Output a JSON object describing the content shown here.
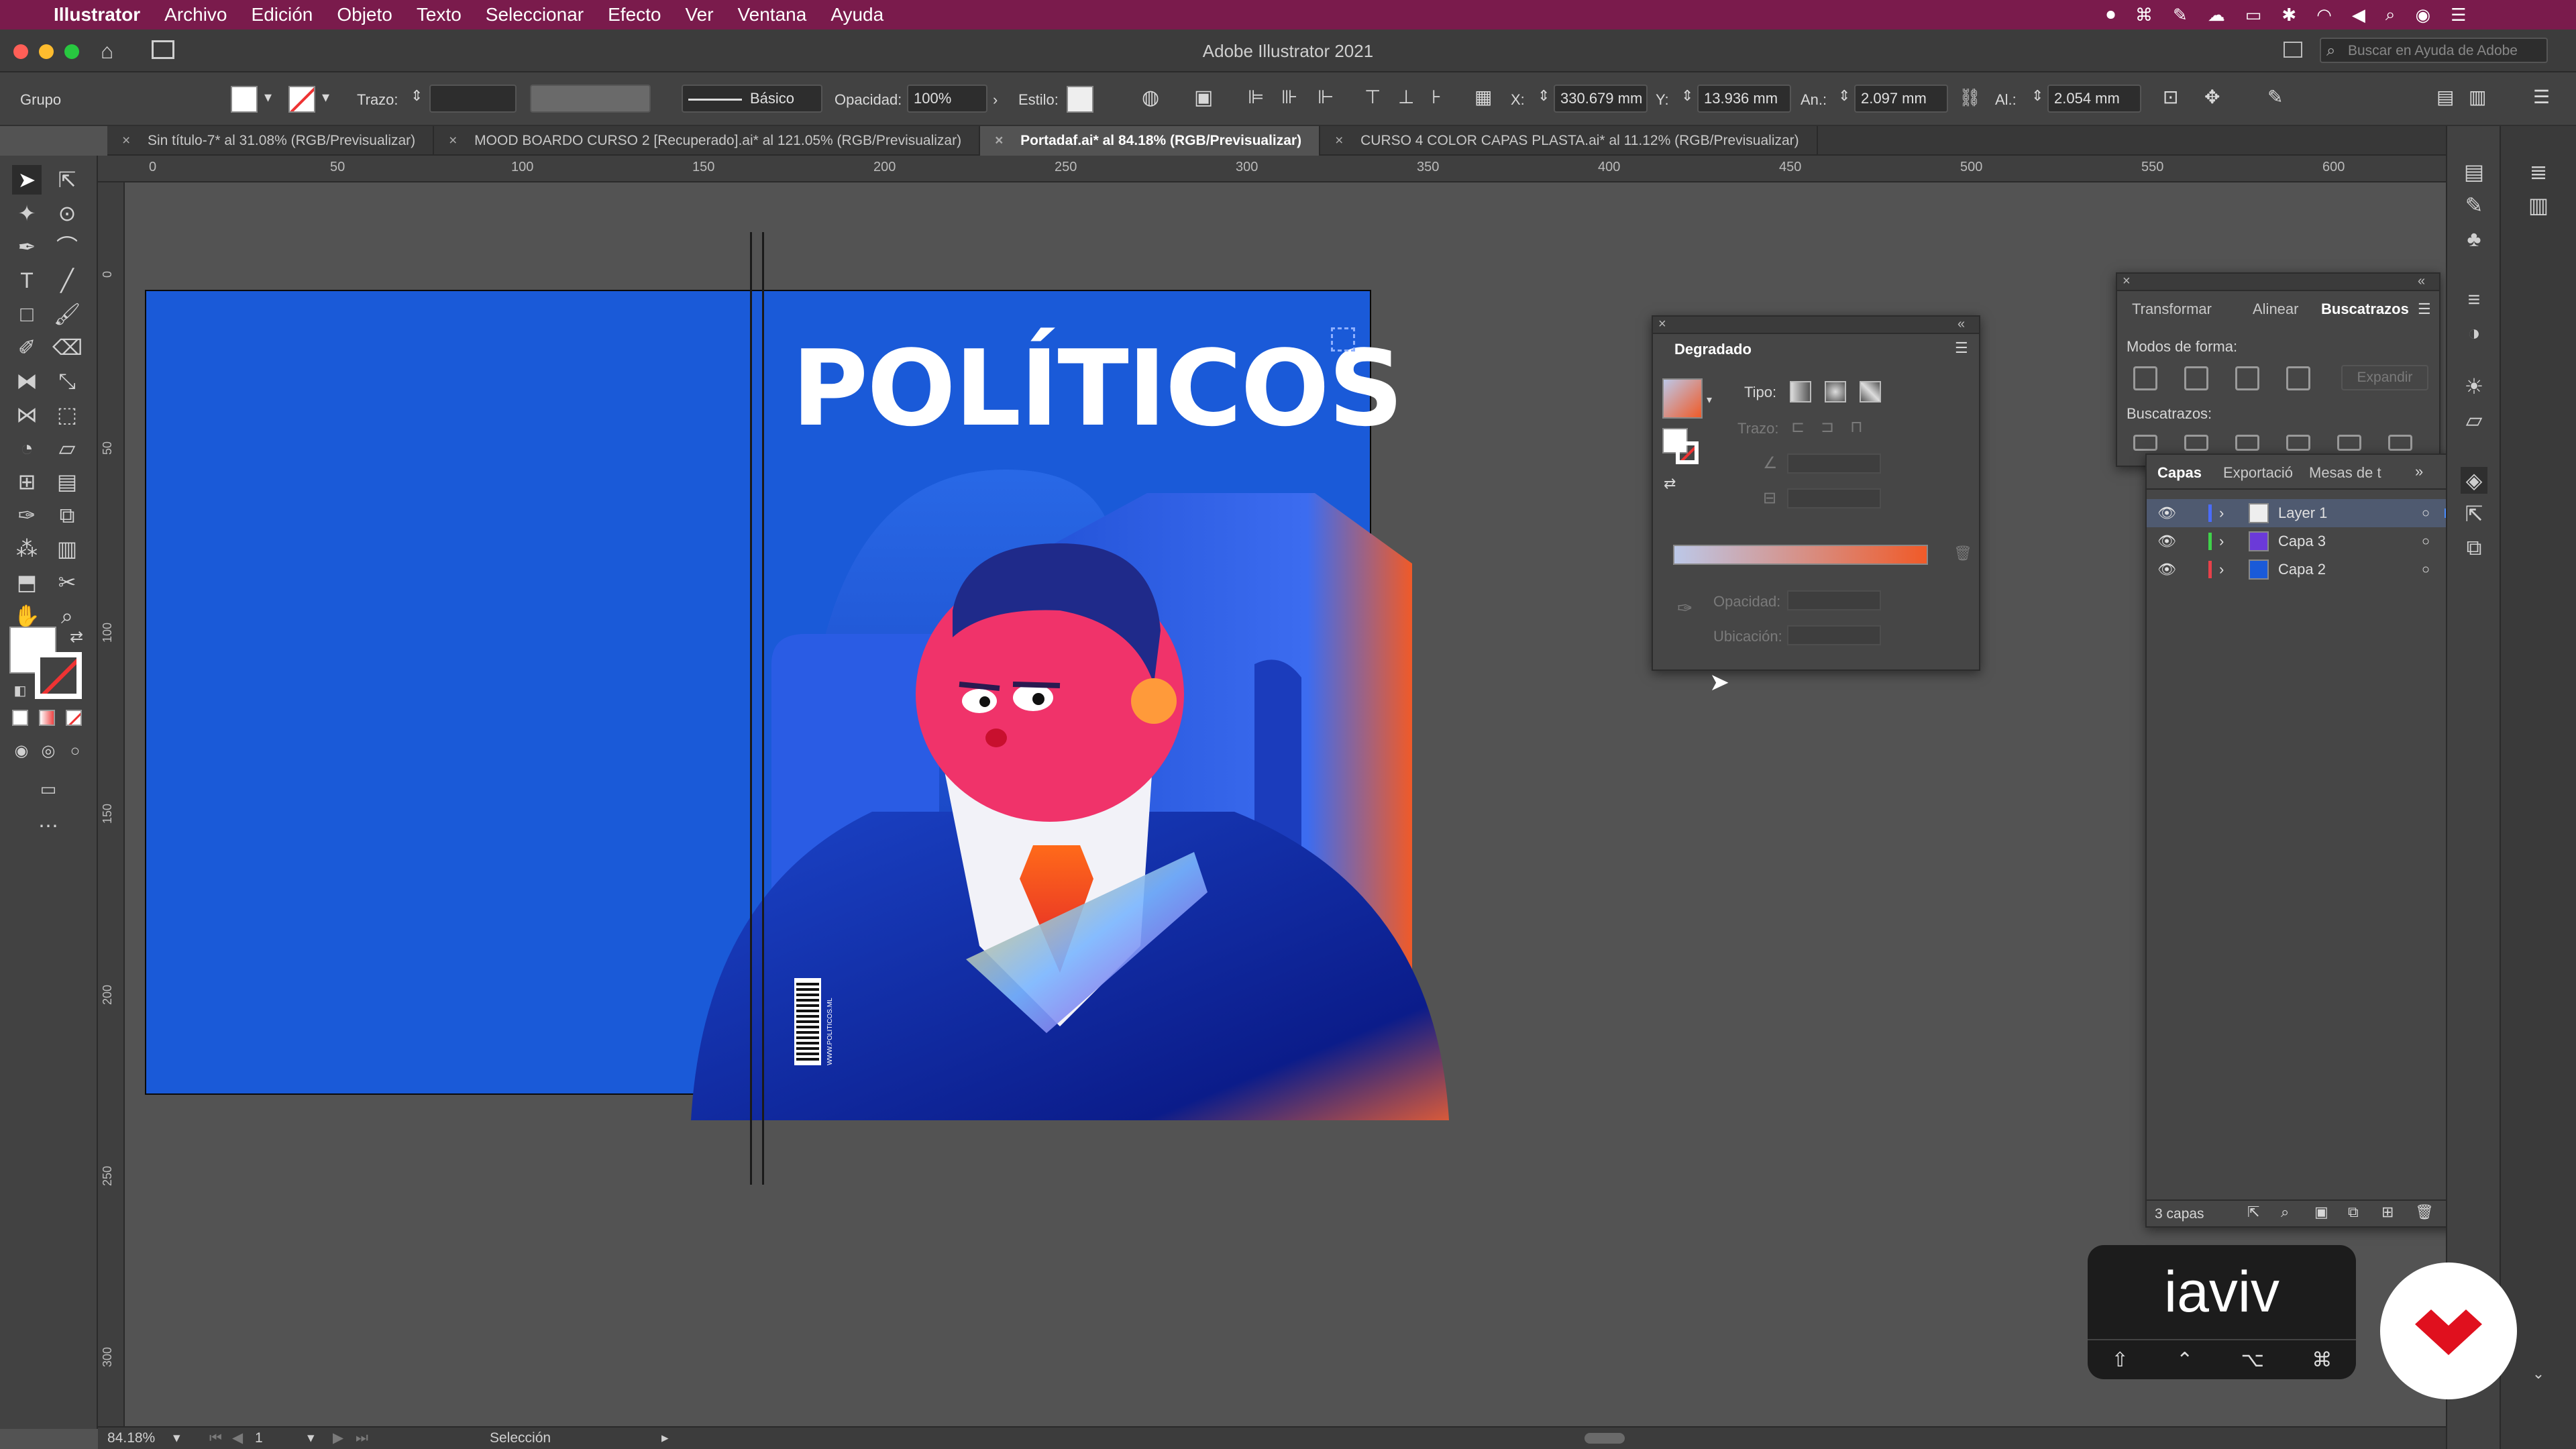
{
  "menubar": {
    "apple": "",
    "app": "Illustrator",
    "items": [
      "Archivo",
      "Edición",
      "Objeto",
      "Texto",
      "Seleccionar",
      "Efecto",
      "Ver",
      "Ventana",
      "Ayuda"
    ]
  },
  "window": {
    "title": "Adobe Illustrator 2021"
  },
  "search": {
    "placeholder": "Buscar en Ayuda de Adobe"
  },
  "control": {
    "selection_type": "Grupo",
    "stroke_label": "Trazo:",
    "stroke_style": "Básico",
    "opacity_label": "Opacidad:",
    "opacity_value": "100%",
    "style_label": "Estilo:",
    "x_label": "X:",
    "x_value": "330.679 mm",
    "y_label": "Y:",
    "y_value": "13.936 mm",
    "w_label": "An.:",
    "w_value": "2.097 mm",
    "h_label": "Al.:",
    "h_value": "2.054 mm"
  },
  "tabs": [
    {
      "label": "Sin título-7* al 31.08% (RGB/Previsualizar)"
    },
    {
      "label": "MOOD BOARDO CURSO 2 [Recuperado].ai* al 121.05% (RGB/Previsualizar)"
    },
    {
      "label": "Portadaf.ai* al 84.18% (RGB/Previsualizar)"
    },
    {
      "label": "CURSO 4 COLOR CAPAS PLASTA.ai* al 11.12% (RGB/Previsualizar)"
    }
  ],
  "ruler": {
    "h_ticks": [
      "0",
      "50",
      "100",
      "150",
      "200",
      "250",
      "300",
      "350",
      "400",
      "450",
      "500",
      "550",
      "600"
    ],
    "v_ticks": [
      "0",
      "50",
      "100",
      "150",
      "200",
      "250",
      "300"
    ]
  },
  "artboard": {
    "headline": "POLÍTICOS",
    "barcode_text": "WWW.POLITICOS.ML"
  },
  "gradient_panel": {
    "title": "Degradado",
    "type_label": "Tipo:",
    "stroke_label": "Trazo:",
    "opacity_label": "Opacidad:",
    "location_label": "Ubicación:"
  },
  "pathfinder_panel": {
    "tabs": [
      "Transformar",
      "Alinear",
      "Buscatrazos"
    ],
    "shape_modes": "Modos de forma:",
    "expand": "Expandir",
    "pathfinders": "Buscatrazos:"
  },
  "layers_panel": {
    "tabs": [
      "Capas",
      "Exportació",
      "Mesas de t"
    ],
    "layers": [
      {
        "name": "Layer 1",
        "color": "#4a6cff"
      },
      {
        "name": "Capa 3",
        "color": "#3fd24a"
      },
      {
        "name": "Capa 2",
        "color": "#e8404a"
      }
    ],
    "count": "3 capas"
  },
  "status": {
    "zoom": "84.18%",
    "artboard": "1",
    "tool": "Selección"
  },
  "keycast": {
    "text": "iaviv",
    "modifiers": [
      "⇧",
      "⌃",
      "⌥",
      "⌘"
    ]
  },
  "colors": {
    "accent": "#7a1b4c",
    "artboard_blue": "#1a5ad8",
    "gradient_end": "#f05a28"
  }
}
